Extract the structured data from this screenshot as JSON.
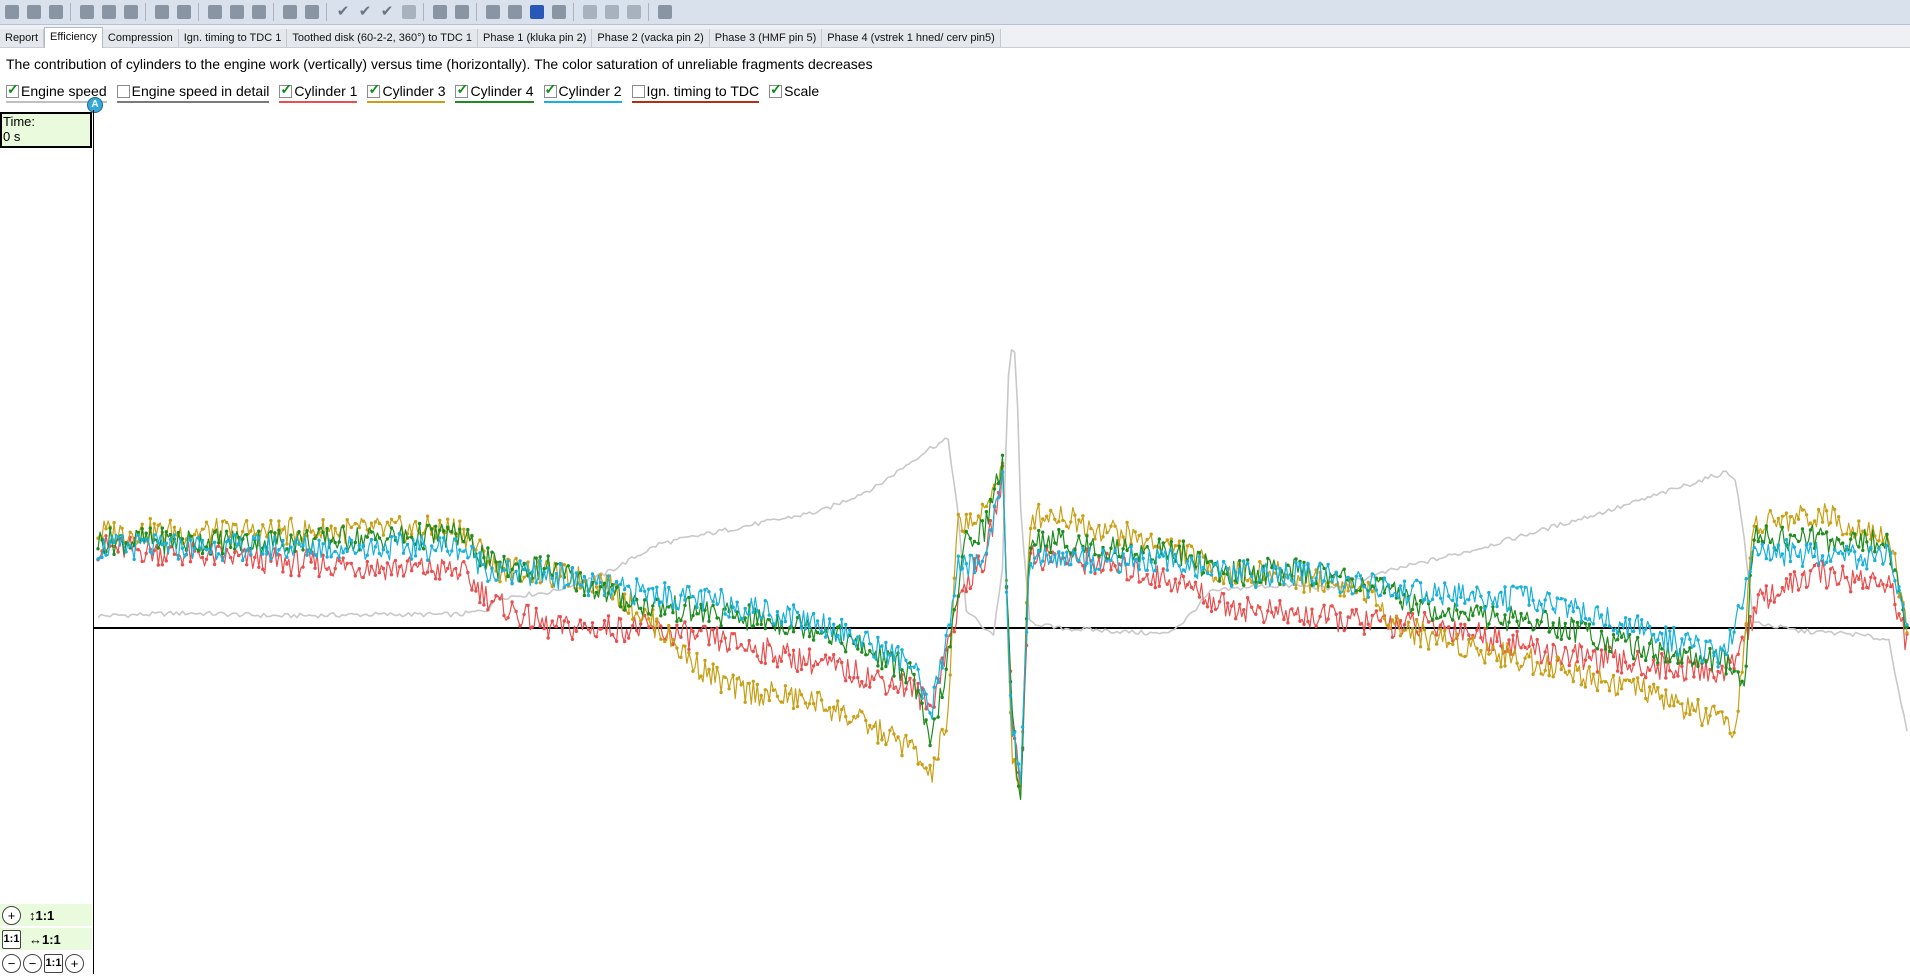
{
  "toolbar": {
    "groups": [
      [
        "open-icon",
        "save-icon",
        "print-icon"
      ],
      [
        "copy-icon",
        "paste-icon",
        "tools-icon"
      ],
      [
        "marker-icon",
        "measure-icon"
      ],
      [
        "waveform-icon",
        "waveform-alt-icon",
        "undo-icon"
      ],
      [
        "select-icon",
        "remove-icon"
      ],
      [
        "check-icon",
        "check-double-icon",
        "check-all-icon",
        "page-icon"
      ],
      [
        "grid-icon",
        "edit-icon"
      ],
      [
        "sequence-icon",
        "play-sequence-icon",
        "stop-sequence-icon",
        "sequence-list-icon"
      ],
      [
        "window-icon",
        "document-icon",
        "delete-icon"
      ],
      [
        "help-icon"
      ]
    ]
  },
  "tabs": [
    {
      "label": "Report",
      "active": false
    },
    {
      "label": "Efficiency",
      "active": true
    },
    {
      "label": "Compression",
      "active": false
    },
    {
      "label": "Ign. timing to TDC 1",
      "active": false
    },
    {
      "label": "Toothed disk (60-2-2, 360°) to TDC 1",
      "active": false
    },
    {
      "label": "Phase 1 (kluka pin 2)",
      "active": false
    },
    {
      "label": "Phase 2 (vacka pin 2)",
      "active": false
    },
    {
      "label": "Phase 3 (HMF pin 5)",
      "active": false
    },
    {
      "label": "Phase 4 (vstrek 1 hned/ cerv pin5)",
      "active": false
    }
  ],
  "description": "The contribution of cylinders to the engine work (vertically) versus time (horizontally). The color saturation of unreliable fragments decreases",
  "legend": [
    {
      "label": "Engine speed",
      "checked": true,
      "color": "#c0c0c0"
    },
    {
      "label": "Engine speed in detail",
      "checked": false,
      "color": "#7a7a7a"
    },
    {
      "label": "Cylinder 1",
      "checked": true,
      "color": "#e8504f"
    },
    {
      "label": "Cylinder 3",
      "checked": true,
      "color": "#c8a018"
    },
    {
      "label": "Cylinder 4",
      "checked": true,
      "color": "#1f8c1f"
    },
    {
      "label": "Cylinder 2",
      "checked": true,
      "color": "#1ab0d8"
    },
    {
      "label": "Ign. timing to TDC",
      "checked": false,
      "color": "#b03010"
    },
    {
      "label": "Scale",
      "checked": true,
      "color": "#ffffff"
    }
  ],
  "time_box": {
    "label": "Time:",
    "value": "0 s"
  },
  "marker": "A",
  "zoom": {
    "vertical": "↕1:1",
    "horizontal": "↔1:1",
    "reset_label": "1:1"
  },
  "chart_data": {
    "type": "line",
    "series": [
      {
        "name": "Engine speed",
        "color": "#c8c8c8",
        "points": [
          [
            0,
            0.04
          ],
          [
            0.05,
            0.05
          ],
          [
            0.1,
            0.04
          ],
          [
            0.15,
            0.045
          ],
          [
            0.2,
            0.045
          ],
          [
            0.215,
            0.06
          ],
          [
            0.22,
            0.1
          ],
          [
            0.25,
            0.12
          ],
          [
            0.28,
            0.18
          ],
          [
            0.31,
            0.28
          ],
          [
            0.35,
            0.33
          ],
          [
            0.4,
            0.39
          ],
          [
            0.43,
            0.47
          ],
          [
            0.46,
            0.6
          ],
          [
            0.47,
            0.63
          ],
          [
            0.475,
            0.4
          ],
          [
            0.48,
            0.06
          ],
          [
            0.49,
            0.0
          ],
          [
            0.495,
            -0.02
          ],
          [
            0.5,
            0.2
          ],
          [
            0.503,
            0.82
          ],
          [
            0.506,
            0.98
          ],
          [
            0.508,
            0.8
          ],
          [
            0.51,
            0.4
          ],
          [
            0.515,
            0.02
          ],
          [
            0.53,
            0.0
          ],
          [
            0.56,
            -0.01
          ],
          [
            0.59,
            -0.02
          ],
          [
            0.6,
            0.02
          ],
          [
            0.615,
            0.12
          ],
          [
            0.64,
            0.14
          ],
          [
            0.67,
            0.14
          ],
          [
            0.68,
            0.13
          ],
          [
            0.72,
            0.2
          ],
          [
            0.76,
            0.26
          ],
          [
            0.8,
            0.33
          ],
          [
            0.84,
            0.4
          ],
          [
            0.87,
            0.46
          ],
          [
            0.89,
            0.5
          ],
          [
            0.9,
            0.52
          ],
          [
            0.905,
            0.5
          ],
          [
            0.91,
            0.3
          ],
          [
            0.915,
            0.02
          ],
          [
            0.94,
            -0.01
          ],
          [
            0.97,
            -0.02
          ],
          [
            0.99,
            -0.04
          ],
          [
            1.0,
            -0.35
          ]
        ]
      },
      {
        "name": "Cylinder 1",
        "color": "#e8504f",
        "points": [
          [
            0,
            0.27
          ],
          [
            0.1,
            0.22
          ],
          [
            0.2,
            0.19
          ],
          [
            0.22,
            0.08
          ],
          [
            0.25,
            0.0
          ],
          [
            0.3,
            0.0
          ],
          [
            0.35,
            -0.05
          ],
          [
            0.4,
            -0.12
          ],
          [
            0.45,
            -0.2
          ],
          [
            0.46,
            -0.27
          ],
          [
            0.47,
            -0.05
          ],
          [
            0.48,
            0.16
          ],
          [
            0.49,
            0.22
          ],
          [
            0.5,
            0.5
          ],
          [
            0.505,
            -0.25
          ],
          [
            0.51,
            -0.55
          ],
          [
            0.515,
            0.24
          ],
          [
            0.55,
            0.22
          ],
          [
            0.6,
            0.15
          ],
          [
            0.62,
            0.08
          ],
          [
            0.65,
            0.05
          ],
          [
            0.7,
            0.02
          ],
          [
            0.75,
            0.0
          ],
          [
            0.8,
            -0.08
          ],
          [
            0.85,
            -0.12
          ],
          [
            0.9,
            -0.15
          ],
          [
            0.92,
            0.1
          ],
          [
            0.95,
            0.18
          ],
          [
            0.99,
            0.15
          ],
          [
            1.0,
            -0.05
          ]
        ]
      },
      {
        "name": "Cylinder 3",
        "color": "#c8a018",
        "points": [
          [
            0,
            0.32
          ],
          [
            0.1,
            0.32
          ],
          [
            0.2,
            0.33
          ],
          [
            0.22,
            0.2
          ],
          [
            0.25,
            0.18
          ],
          [
            0.28,
            0.15
          ],
          [
            0.31,
            0.0
          ],
          [
            0.33,
            -0.12
          ],
          [
            0.35,
            -0.2
          ],
          [
            0.4,
            -0.25
          ],
          [
            0.45,
            -0.4
          ],
          [
            0.46,
            -0.5
          ],
          [
            0.47,
            -0.3
          ],
          [
            0.475,
            0.35
          ],
          [
            0.49,
            0.37
          ],
          [
            0.5,
            0.56
          ],
          [
            0.505,
            -0.4
          ],
          [
            0.51,
            -0.58
          ],
          [
            0.515,
            0.37
          ],
          [
            0.53,
            0.38
          ],
          [
            0.55,
            0.34
          ],
          [
            0.6,
            0.26
          ],
          [
            0.62,
            0.18
          ],
          [
            0.65,
            0.18
          ],
          [
            0.7,
            0.13
          ],
          [
            0.72,
            0.0
          ],
          [
            0.75,
            -0.05
          ],
          [
            0.8,
            -0.12
          ],
          [
            0.85,
            -0.2
          ],
          [
            0.9,
            -0.32
          ],
          [
            0.905,
            -0.4
          ],
          [
            0.915,
            0.34
          ],
          [
            0.95,
            0.38
          ],
          [
            0.99,
            0.31
          ],
          [
            1.0,
            0.0
          ]
        ]
      },
      {
        "name": "Cylinder 4",
        "color": "#1f8c1f",
        "points": [
          [
            0,
            0.29
          ],
          [
            0.1,
            0.29
          ],
          [
            0.2,
            0.31
          ],
          [
            0.22,
            0.2
          ],
          [
            0.25,
            0.2
          ],
          [
            0.28,
            0.12
          ],
          [
            0.3,
            0.08
          ],
          [
            0.35,
            0.04
          ],
          [
            0.4,
            0.0
          ],
          [
            0.45,
            -0.15
          ],
          [
            0.46,
            -0.4
          ],
          [
            0.47,
            -0.1
          ],
          [
            0.48,
            0.3
          ],
          [
            0.49,
            0.33
          ],
          [
            0.5,
            0.55
          ],
          [
            0.505,
            -0.3
          ],
          [
            0.51,
            -0.56
          ],
          [
            0.515,
            0.3
          ],
          [
            0.55,
            0.27
          ],
          [
            0.6,
            0.25
          ],
          [
            0.62,
            0.18
          ],
          [
            0.65,
            0.19
          ],
          [
            0.68,
            0.18
          ],
          [
            0.7,
            0.15
          ],
          [
            0.72,
            0.1
          ],
          [
            0.75,
            0.05
          ],
          [
            0.8,
            0.02
          ],
          [
            0.85,
            -0.06
          ],
          [
            0.9,
            -0.12
          ],
          [
            0.91,
            -0.2
          ],
          [
            0.915,
            0.3
          ],
          [
            0.95,
            0.3
          ],
          [
            0.99,
            0.28
          ],
          [
            1.0,
            0.0
          ]
        ]
      },
      {
        "name": "Cylinder 2",
        "color": "#1ab0d8",
        "points": [
          [
            0,
            0.27
          ],
          [
            0.1,
            0.27
          ],
          [
            0.2,
            0.27
          ],
          [
            0.22,
            0.18
          ],
          [
            0.25,
            0.18
          ],
          [
            0.28,
            0.13
          ],
          [
            0.3,
            0.12
          ],
          [
            0.35,
            0.08
          ],
          [
            0.4,
            0.02
          ],
          [
            0.45,
            -0.12
          ],
          [
            0.46,
            -0.3
          ],
          [
            0.47,
            0.0
          ],
          [
            0.475,
            0.2
          ],
          [
            0.49,
            0.22
          ],
          [
            0.5,
            0.53
          ],
          [
            0.505,
            -0.3
          ],
          [
            0.51,
            -0.55
          ],
          [
            0.515,
            0.24
          ],
          [
            0.55,
            0.23
          ],
          [
            0.6,
            0.22
          ],
          [
            0.62,
            0.18
          ],
          [
            0.65,
            0.18
          ],
          [
            0.68,
            0.17
          ],
          [
            0.7,
            0.14
          ],
          [
            0.72,
            0.12
          ],
          [
            0.75,
            0.11
          ],
          [
            0.8,
            0.09
          ],
          [
            0.85,
            0.0
          ],
          [
            0.9,
            -0.1
          ],
          [
            0.915,
            0.25
          ],
          [
            0.95,
            0.25
          ],
          [
            0.99,
            0.23
          ],
          [
            1.0,
            0.0
          ]
        ]
      }
    ]
  }
}
